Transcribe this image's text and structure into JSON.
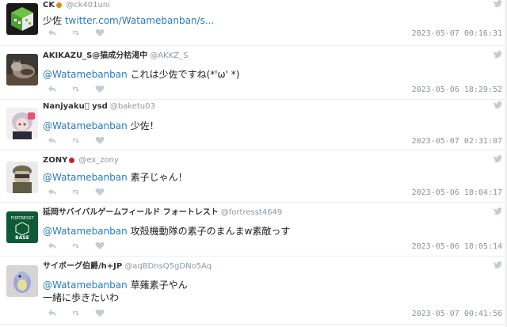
{
  "tweets": [
    {
      "name": "CK",
      "handle": "@ck401uni",
      "text_prefix": "少佐 ",
      "link": "twitter.com/Watamebanban/s...",
      "mention": "",
      "text": "",
      "text2": "",
      "time": "2023-05-07 00:16:31",
      "badge_color": "#d38b19",
      "avatar": "green-cube"
    },
    {
      "name": "AKIKAZU_S@猫成分枯渇中",
      "handle": "@AKKZ_S",
      "mention": "@Watamebanban",
      "text": "これは少佐ですね(*'ω' *)",
      "text2": "",
      "time": "2023-05-06 18:29:52",
      "avatar": "cat"
    },
    {
      "name": "Nanjyaku\u0000 ysd",
      "handle": "@baketu03",
      "mention": "@Watamebanban",
      "text": "少佐！",
      "text2": "",
      "time": "2023-05-07 02:31:07",
      "avatar": "anime-girl"
    },
    {
      "name": "ZONY",
      "handle": "@ex_zony",
      "mention": "@Watamebanban",
      "text": "素子じゃん！",
      "text2": "",
      "time": "2023-05-06 18:04:17",
      "badge_color": "#cc2222",
      "avatar": "soldier"
    },
    {
      "name": "延岡サバイバルゲームフィールド フォートレスト",
      "handle": "@fortresst4649",
      "mention": "@Watamebanban",
      "text": "攻殻機動隊の素子のまんまw素敵っす",
      "text2": "",
      "time": "2023-05-06 18:05:14",
      "avatar": "fortress-logo",
      "avatar_text_top": "FORTRESST",
      "avatar_text_bottom": "BASE"
    },
    {
      "name": "サイボーグ伯爵/h+JP",
      "handle": "@aqBDnsQ5gDNo5Aq",
      "mention": "@Watamebanban",
      "text": "草薙素子やん",
      "text2": "一緒に歩きたいわ",
      "time": "2023-05-07 00:41:56",
      "avatar": "bird"
    }
  ],
  "colors": {
    "link": "#2b7bb9",
    "meta": "#8899a6",
    "icon": "#c4ccd2"
  },
  "icons": {
    "reply": "reply-icon",
    "retweet": "retweet-icon",
    "like": "like-icon",
    "brand": "twitter-bird-icon"
  }
}
